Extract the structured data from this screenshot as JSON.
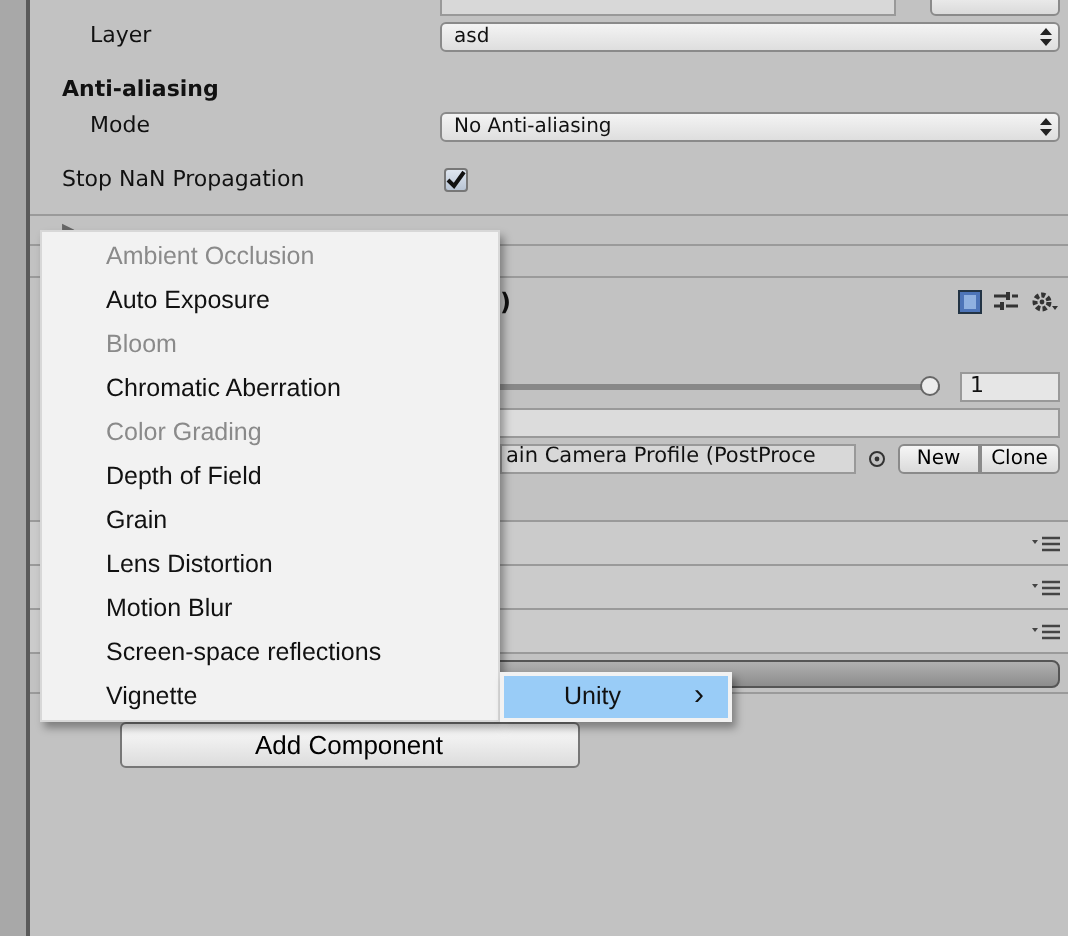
{
  "inspector": {
    "layer": {
      "label": "Layer",
      "value": "asd"
    },
    "anti_aliasing": {
      "heading": "Anti-aliasing",
      "mode_label": "Mode",
      "mode_value": "No Anti-aliasing"
    },
    "stop_nan": {
      "label": "Stop NaN Propagation",
      "checked": true
    },
    "toolkit": {
      "arrow": "▶"
    },
    "component": {
      "title_tail": ")",
      "weight": {
        "level": 1,
        "value": "1"
      },
      "profile": {
        "value": "ain Camera Profile (PostProce",
        "buttons": [
          "New",
          "Clone"
        ]
      }
    },
    "add_component": "Add Component"
  },
  "menu": {
    "items": [
      {
        "label": "Ambient Occlusion",
        "disabled": true
      },
      {
        "label": "Auto Exposure",
        "disabled": false
      },
      {
        "label": "Bloom",
        "disabled": true
      },
      {
        "label": "Chromatic Aberration",
        "disabled": false
      },
      {
        "label": "Color Grading",
        "disabled": true
      },
      {
        "label": "Depth of Field",
        "disabled": false
      },
      {
        "label": "Grain",
        "disabled": false
      },
      {
        "label": "Lens Distortion",
        "disabled": false
      },
      {
        "label": "Motion Blur",
        "disabled": false
      },
      {
        "label": "Screen-space reflections",
        "disabled": false
      },
      {
        "label": "Vignette",
        "disabled": false
      }
    ]
  },
  "submenu": {
    "items": [
      {
        "label": "Unity",
        "arrow": "›",
        "selected": true
      }
    ]
  }
}
